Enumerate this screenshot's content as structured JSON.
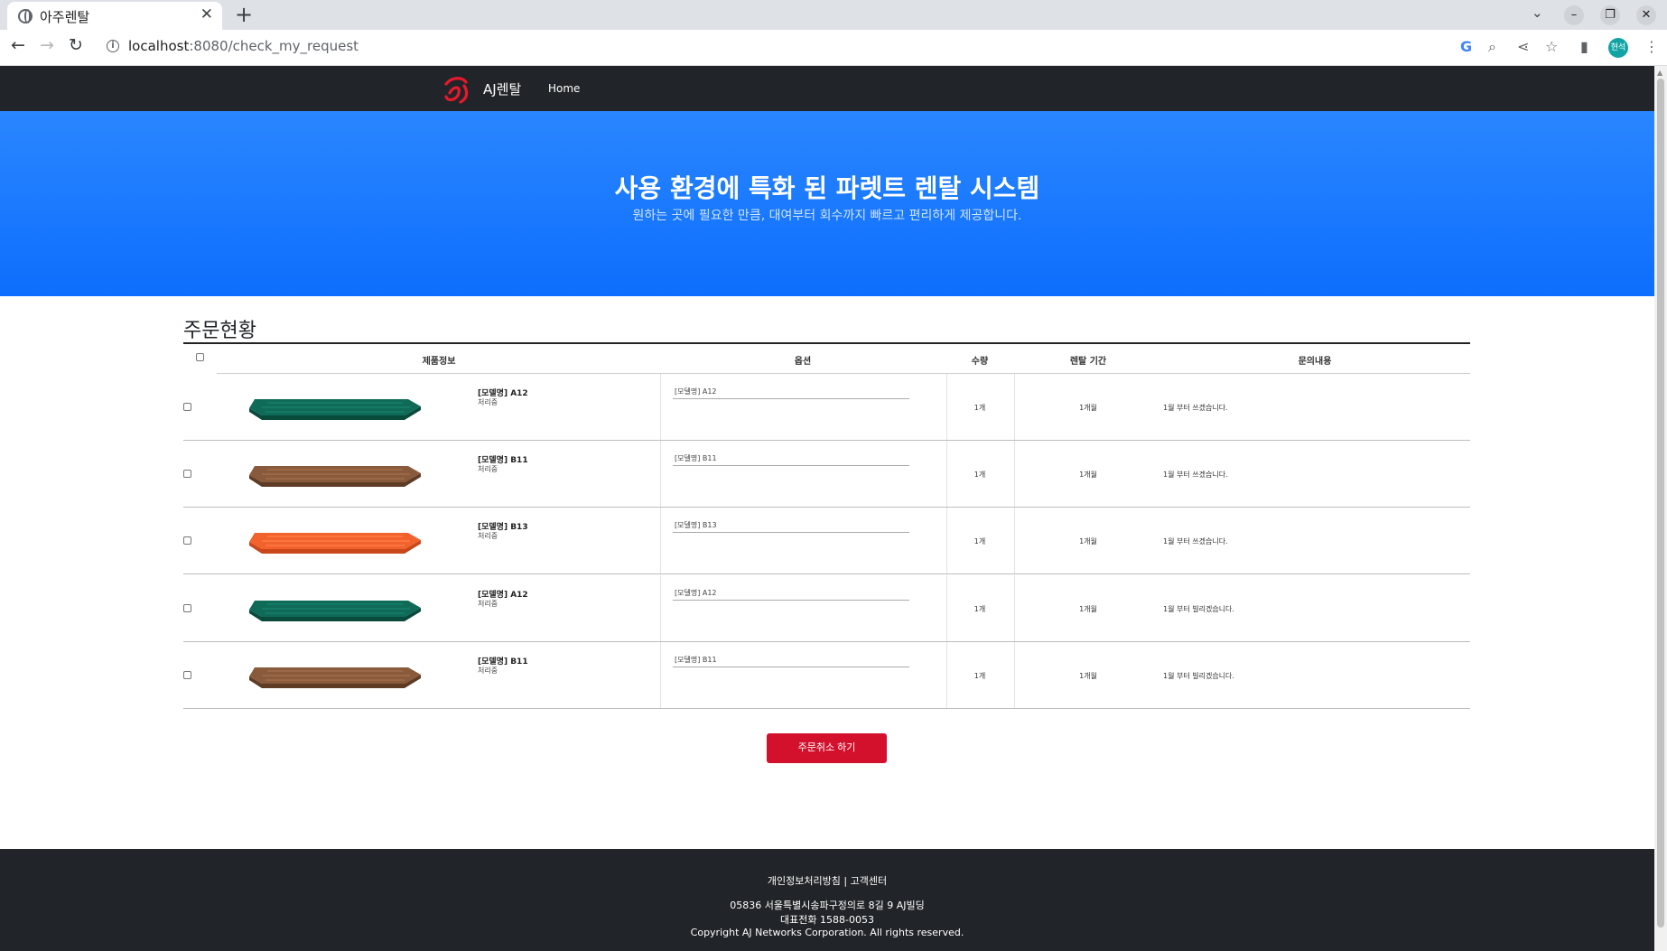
{
  "browser": {
    "tab_title": "아주렌탈",
    "url_host": "localhost",
    "url_rest": ":8080/check_my_request",
    "profile_initials": "현석"
  },
  "site": {
    "brand": "AJ렌탈",
    "nav_home": "Home"
  },
  "hero": {
    "title": "사용 환경에 특화 된 파렛트 렌탈 시스템",
    "subtitle": "원하는 곳에 필요한 만큼, 대여부터 회수까지 빠르고 편리하게 제공합니다."
  },
  "orders": {
    "section_title": "주문현황",
    "headers": {
      "product": "제품정보",
      "option": "옵션",
      "quantity": "수량",
      "period": "렌탈 기간",
      "inquiry": "문의내용"
    },
    "rows": [
      {
        "name": "[모델명] A12",
        "status": "처리중",
        "option": "[모델명] A12",
        "quantity": "1개",
        "period": "1개월",
        "inquiry": "1월 부터 쓰겠습니다.",
        "color": "green"
      },
      {
        "name": "[모델명] B11",
        "status": "처리중",
        "option": "[모델명] B11",
        "quantity": "1개",
        "period": "1개월",
        "inquiry": "1월 부터 쓰겠습니다.",
        "color": "brown"
      },
      {
        "name": "[모델명] B13",
        "status": "처리중",
        "option": "[모델명] B13",
        "quantity": "1개",
        "period": "1개월",
        "inquiry": "1월 부터 쓰겠습니다.",
        "color": "orange"
      },
      {
        "name": "[모델명] A12",
        "status": "처리중",
        "option": "[모델명] A12",
        "quantity": "1개",
        "period": "1개월",
        "inquiry": "1월 부터 빌리겠습니다.",
        "color": "green"
      },
      {
        "name": "[모델명] B11",
        "status": "처리중",
        "option": "[모델명] B11",
        "quantity": "1개",
        "period": "1개월",
        "inquiry": "1월 부터 빌리겠습니다.",
        "color": "brown"
      }
    ],
    "cancel_label": "주문취소 하기"
  },
  "footer": {
    "links": "개인정보처리방침 | 고객센터",
    "address": "05836 서울특별시송파구정의로 8길 9 AJ빌딩",
    "phone": "대표전화 1588-0053",
    "copyright": "Copyright AJ Networks Corporation. All rights reserved."
  },
  "colors": {
    "nav_bg": "#212529",
    "hero_blue": "#0d6efd",
    "cancel_red": "#d3112d",
    "pallet_green": "#0f6b57",
    "pallet_brown": "#8a5a3c",
    "pallet_orange": "#f2622d"
  }
}
